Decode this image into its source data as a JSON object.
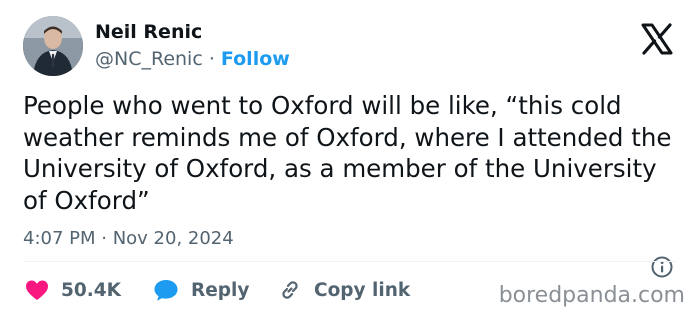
{
  "author": {
    "name": "Neil Renic",
    "handle": "@NC_Renic",
    "separator": " · ",
    "follow_label": "Follow"
  },
  "tweet": {
    "text": "People who went to Oxford will be like, “this cold weather reminds me of Oxford, where I attended the University of Oxford, as a member of the University of Oxford”",
    "timestamp": "4:07 PM · Nov 20, 2024"
  },
  "actions": {
    "likes_count": "50.4K",
    "reply_label": "Reply",
    "copy_link_label": "Copy link"
  },
  "watermark": "boredpanda.com",
  "colors": {
    "like": "#f91880",
    "reply": "#1d9bf0",
    "follow": "#1d9bf0",
    "secondary_text": "#536471"
  },
  "icons": {
    "brand": "x-logo-icon",
    "info": "info-icon",
    "like": "heart-icon",
    "reply": "speech-bubble-icon",
    "copy": "link-icon"
  }
}
